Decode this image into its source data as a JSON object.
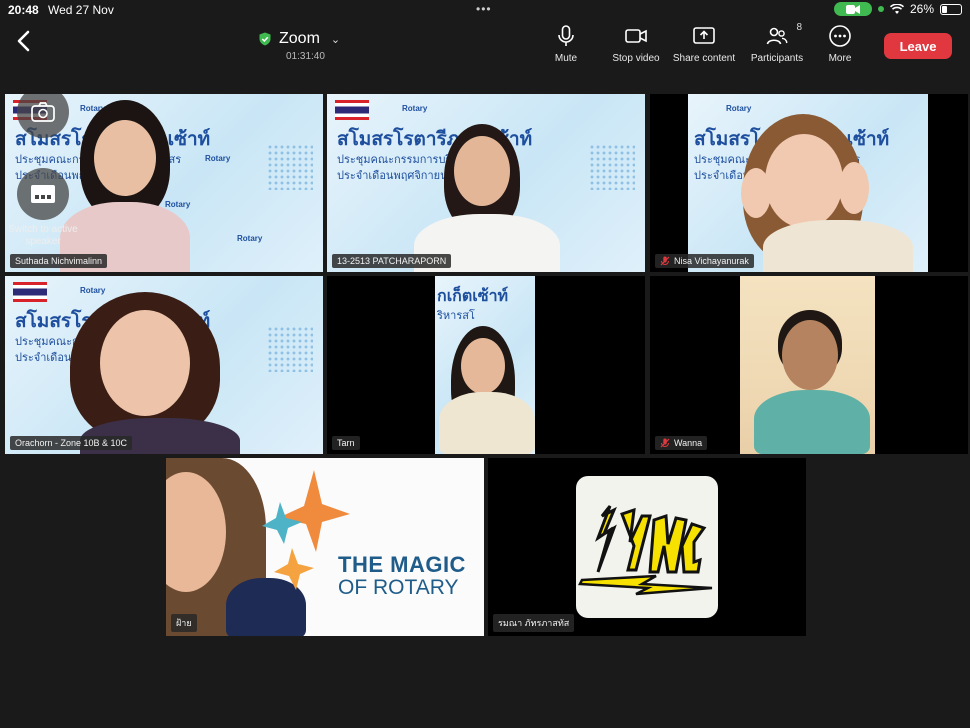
{
  "status_bar": {
    "time": "20:48",
    "date": "Wed 27 Nov",
    "battery": "26%"
  },
  "meeting": {
    "title": "Zoom",
    "elapsed": "01:31:40"
  },
  "toolbar": {
    "mute": "Mute",
    "stop_video": "Stop video",
    "share": "Share content",
    "participants": "Participants",
    "participants_count": "8",
    "more": "More",
    "leave": "Leave"
  },
  "overlay": {
    "switch_speaker": "Switch to active speaker"
  },
  "slide": {
    "title": "สโมสรโรตารีภูเก็ตเซ้าท์",
    "line1": "ประชุมคณะกรรมการบริหารสโมสร",
    "line2": "ประจำเดือนพฤศจิกายน 2567",
    "rotary": "Rotary",
    "club": "Club of Phuket South"
  },
  "tiles": [
    {
      "name": "Suthada Nichvimalinn",
      "muted": false
    },
    {
      "name": "13-2513 PATCHARAPORN",
      "muted": false
    },
    {
      "name": "Nisa  Vichayanurak",
      "muted": true
    },
    {
      "name": "Orachorn - Zone 10B & 10C",
      "muted": false
    },
    {
      "name": "Tarn",
      "muted": false
    },
    {
      "name": "Wanna",
      "muted": true
    },
    {
      "name": "ฝ้าย",
      "muted": false
    },
    {
      "name": "รมณา ภัทรภาสทัส",
      "muted": false
    }
  ],
  "magic": {
    "line1": "THE MAGIC",
    "line2": "OF ROTARY"
  },
  "colors": {
    "leave": "#e0383e",
    "active_border": "#5ec46a",
    "muted_icon": "#e0383e",
    "slide_blue": "#1e4f9e"
  }
}
